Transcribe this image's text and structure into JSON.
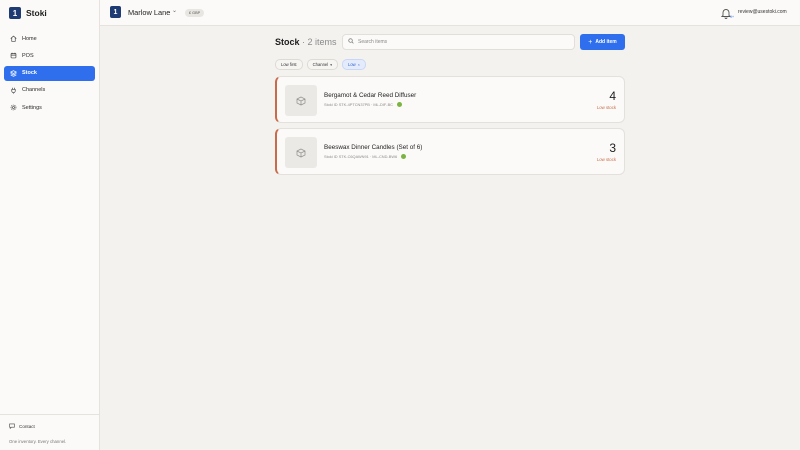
{
  "app": {
    "name": "Stoki",
    "logo_letter": "1"
  },
  "sidebar": {
    "items": [
      {
        "label": "Home",
        "icon": "home-icon"
      },
      {
        "label": "POS",
        "icon": "pos-icon"
      },
      {
        "label": "Stock",
        "icon": "stock-icon",
        "active": true
      },
      {
        "label": "Channels",
        "icon": "channels-icon"
      },
      {
        "label": "Settings",
        "icon": "gear-icon"
      }
    ],
    "contact_label": "Contact",
    "tagline": "One inventory. Every channel."
  },
  "header": {
    "store_name": "Marlow Lane",
    "currency": "£ GBP",
    "notification_badge": "9+",
    "user_email": "review@usestoki.com"
  },
  "main": {
    "title": "Stock",
    "count": "· 2 items",
    "search_placeholder": "Search items",
    "add_button_label": "Add item",
    "filters": [
      {
        "label": "Low first"
      },
      {
        "label": "Channel",
        "caret": "▾"
      },
      {
        "label": "Low",
        "caret": "×",
        "active": true
      }
    ],
    "items": [
      {
        "name": "Bergamot & Cedar Reed Diffuser",
        "stoki_id": "Stoki ID STK-4PTCN37PB",
        "sku": "ML-DIF-BC",
        "qty": "4",
        "status": "Low stock"
      },
      {
        "name": "Beeswax Dinner Candles (Set of 6)",
        "stoki_id": "Stoki ID STK-C6QAWN91",
        "sku": "ML-CND-BW6",
        "qty": "3",
        "status": "Low stock"
      }
    ]
  },
  "colors": {
    "accent": "#2f6fed",
    "brand": "#1f3b73",
    "warning": "#c96b4a",
    "ok": "#7cb342"
  }
}
